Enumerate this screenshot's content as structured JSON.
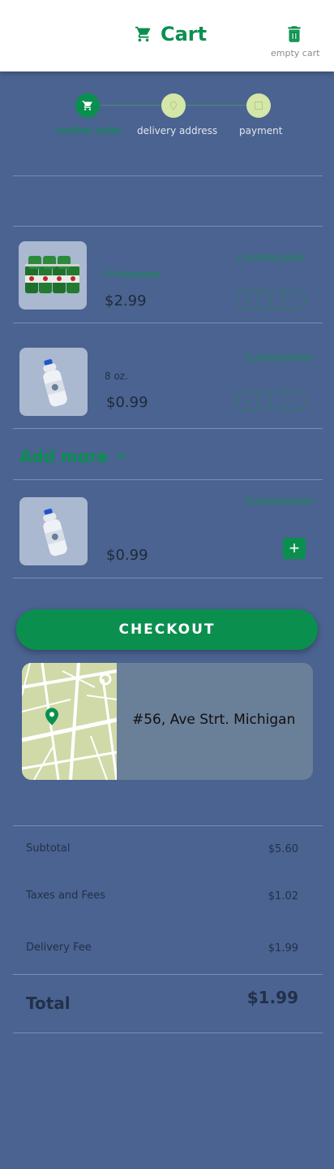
{
  "header": {
    "title": "Cart",
    "cart_icon": "cart-icon",
    "trash_icon": "trash-icon",
    "empty_label": "empty cart"
  },
  "stepper": {
    "steps": [
      {
        "label": "confirm order",
        "icon": "cart-icon",
        "state": "active"
      },
      {
        "label": "delivery address",
        "icon": "location-pin-icon",
        "state": "pending"
      },
      {
        "label": "payment",
        "icon": "card-icon",
        "state": "pending"
      }
    ]
  },
  "items": [
    {
      "variant": "6*heineken",
      "price": "$2.99",
      "customizable": "Customizable",
      "qty_minus": "+",
      "qty_value": "|",
      "qty_plus": "−"
    },
    {
      "variant": "8 oz.",
      "price": "$0.99",
      "customizable": "Customizable",
      "qty_minus": "+",
      "qty_value": "|",
      "qty_plus": "−"
    }
  ],
  "add_more": {
    "label": "Add more",
    "icon": "chevron-down-icon",
    "items": [
      {
        "price": "$0.99",
        "customizable": "Customizable",
        "add_symbol": "+"
      }
    ]
  },
  "checkout": {
    "label": "CHECKOUT"
  },
  "address": {
    "text": "#56, Ave Strt. Michigan",
    "pin_icon": "map-pin-icon"
  },
  "summary": {
    "subtotal_label": "Subtotal",
    "subtotal_value": "$5.60",
    "taxes_label": "Taxes and Fees",
    "taxes_value": "$1.02",
    "delivery_label": "Delivery Fee",
    "delivery_value": "$1.99",
    "total_label": "Total",
    "total_value": "$1.99"
  },
  "colors": {
    "accent": "#0a8f4f",
    "background": "#4a6390",
    "header_bg": "#ffffff",
    "step_pending": "#d4e6a8"
  }
}
